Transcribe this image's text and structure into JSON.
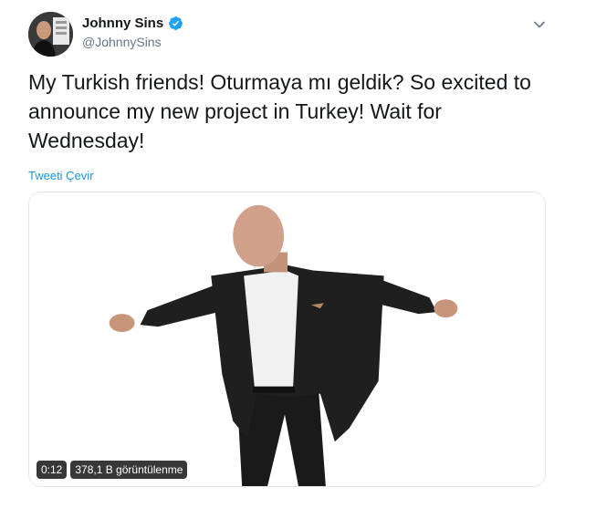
{
  "user": {
    "display_name": "Johnny Sins",
    "handle": "@JohnnySins",
    "verified": true
  },
  "tweet": {
    "text_line1": "My Turkish friends! Oturmaya mı geldik? So excited to",
    "text_line2": "announce my new project in Turkey! Wait for",
    "text_line3": "Wednesday!",
    "translate_label": "Tweeti Çevir"
  },
  "video": {
    "duration": "0:12",
    "views": "378,1 B görüntülenme"
  },
  "icons": {
    "verified": "verified-badge-icon",
    "menu": "chevron-down-icon"
  },
  "colors": {
    "link": "#1b95e0",
    "verified": "#1da1f2",
    "text": "#14171a",
    "secondary": "#657786"
  }
}
